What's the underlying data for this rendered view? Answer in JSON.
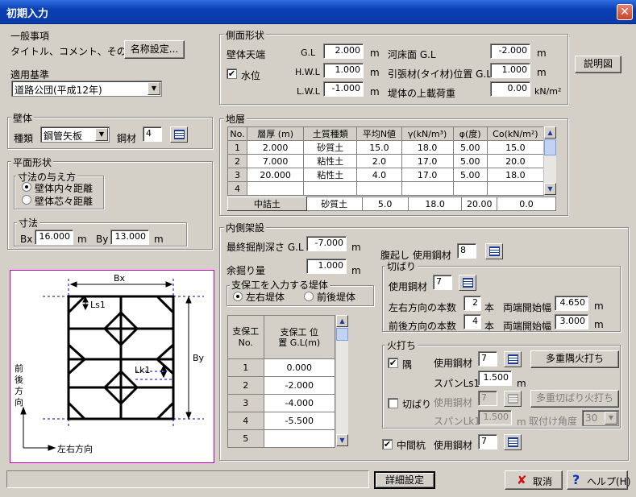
{
  "window": {
    "title": "初期入力",
    "close": "✕"
  },
  "general": {
    "title": "一般事項",
    "label": "タイトル、コメント、その他:",
    "button": "名称設定..."
  },
  "standard": {
    "title": "適用基準",
    "value": "道路公団(平成12年)"
  },
  "wall": {
    "title": "壁体",
    "type_label": "種類",
    "type_value": "鋼管矢板",
    "steel_label": "鋼材",
    "steel_value": "4"
  },
  "plan": {
    "title": "平面形状",
    "method_title": "寸法の与え方",
    "options": [
      "壁体内々距離",
      "壁体芯々距離"
    ],
    "dims_title": "寸法",
    "bx_label": "Bx",
    "bx": "16.000",
    "by_label": "By",
    "by": "13.000",
    "unit": "m"
  },
  "side": {
    "title": "側面形状",
    "wall_top_label": "壁体天端",
    "gl_label": "G.L",
    "gl": "2.000",
    "water_label": "水位",
    "hwl_label": "H.W.L",
    "hwl": "1.000",
    "lwl_label": "L.W.L",
    "lwl": "-1.000",
    "riverbed_label": "河床面 G.L",
    "riverbed": "-2.000",
    "tie_label": "引張材(タイ材)位置 G.L",
    "tie": "1.000",
    "load_label": "堤体の上載荷重",
    "load": "0.00",
    "unit_m": "m",
    "unit_load": "kN/m²",
    "explain_button": "説明図"
  },
  "strata": {
    "title": "地層",
    "headers": [
      "No.",
      "層厚 (m)",
      "土質種類",
      "平均N値",
      "γ(kN/m³)",
      "φ(度)",
      "Co(kN/m²)"
    ],
    "rows": [
      [
        "1",
        "2.000",
        "砂質土",
        "15.0",
        "18.0",
        "5.00",
        "15.0"
      ],
      [
        "2",
        "7.000",
        "粘性土",
        "2.0",
        "17.0",
        "5.00",
        "20.0"
      ],
      [
        "3",
        "20.000",
        "粘性土",
        "4.0",
        "17.0",
        "5.00",
        "18.0"
      ],
      [
        "4",
        "",
        "",
        "",
        "",
        "",
        ""
      ]
    ],
    "fill_row": [
      "中詰土",
      "砂質土",
      "5.0",
      "18.0",
      "20.00",
      "0.0"
    ]
  },
  "inner": {
    "title": "内側架設",
    "excavation_label": "最終掘削深さ G.L",
    "excavation": "-7.000",
    "extra_label": "余掘り量",
    "extra": "1.000",
    "unit": "m",
    "support_embank_title": "支保工を入力する堤体",
    "embank_options": [
      "左右堤体",
      "前後堤体"
    ],
    "support_headers": [
      "支保工 No.",
      "支保工 位置 G.L(m)"
    ],
    "supports": [
      [
        "1",
        "0.000"
      ],
      [
        "2",
        "-2.000"
      ],
      [
        "3",
        "-4.000"
      ],
      [
        "4",
        "-5.500"
      ],
      [
        "5",
        ""
      ]
    ],
    "waist_label": "腹起し 使用鋼材",
    "waist": "8",
    "strut_title": "切ばり",
    "strut_steel_label": "使用鋼材",
    "strut_steel": "7",
    "lr_count_label": "左右方向の本数",
    "lr_count": "2",
    "fb_count_label": "前後方向の本数",
    "fb_count": "4",
    "count_unit": "本",
    "start_width_label": "両端開始幅",
    "lr_width": "4.650",
    "fb_width": "3.000",
    "fire_title": "火打ち",
    "corner_label": "隅",
    "corner_steel_label": "使用鋼材",
    "corner_steel": "7",
    "multi_corner_button": "多重隅火打ち",
    "span_ls1_label": "スパンLs1",
    "span_ls1": "1.500",
    "strut_fire_label": "切ばり",
    "strut_fire_steel_label": "使用鋼材",
    "strut_fire_steel": "7",
    "multi_strut_button": "多重切ばり火打ち",
    "span_lk1_label": "スパンLk1",
    "span_lk1": "1.500",
    "angle_label": "取付け角度",
    "angle": "30",
    "middle_pile_label": "中間杭",
    "middle_steel_label": "使用鋼材",
    "middle_steel": "7"
  },
  "diagram": {
    "bx": "Bx",
    "by": "By",
    "ls1": "Ls1",
    "lk1": "Lk1",
    "front_back": [
      "前",
      "後",
      "方",
      "向"
    ],
    "left_right": "左右方向"
  },
  "footer": {
    "detail_button": "詳細設定",
    "cancel_button": "取消",
    "help_button": "ヘルプ(H)"
  }
}
